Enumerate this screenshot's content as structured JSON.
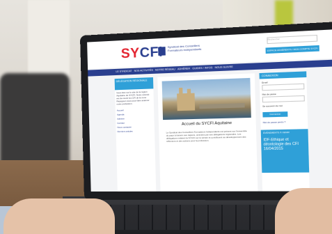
{
  "site": {
    "logo_sy": "SY",
    "logo_cfi": "CFI",
    "tagline": "Syndicat des Conseillers Formateurs Indépendants",
    "search_placeholder": "Rechercher",
    "member_button": "ESPACE ADHÉRENTS / MON COMPTE SYCFI",
    "nav": [
      "LE SYNDICAT",
      "NOS ACTIVITÉS",
      "NOTRE RÉSEAU",
      "ADHÉRER",
      "GUIDES / INFOS",
      "NOUS SUIVRE"
    ]
  },
  "left_col": {
    "heading": "DÉLÉGATION RÉGIONALE",
    "text": "Vous êtes sur le site de la région Aquitaine du SYCFI. Notre volonté est de réunir les CFI de la zone. Rejoignez-nous pour faire avancer notre profession.",
    "links": [
      "Accueil",
      "Agenda",
      "Adhérer",
      "Contact",
      "Nous contacter"
    ],
    "footer": "Derniers articles"
  },
  "center": {
    "title": "Accueil du SYCFI Aquitaine",
    "paragraph": "Le Syndicat des Conseillers Formateurs Indépendants est présent sur l'ensemble du pays à travers ses régions, animées par ses délégations régionales. Les délégations relaient la SYCFI sur le terrain et contribuent au développement des réflexions et des actions pour la profession."
  },
  "right_col": {
    "connect_heading": "CONNEXION",
    "login_label": "Email",
    "password_label": "Mot de passe",
    "remember_label": "Se souvenir de moi",
    "connect_button": "Connexion",
    "forgot_link": "Mot de passe perdu ?",
    "event_heading": "ÉVÉNEMENTS À VENIR",
    "event_title": "IDF-Ethique et déontologie des CFI 16/04/2015"
  }
}
